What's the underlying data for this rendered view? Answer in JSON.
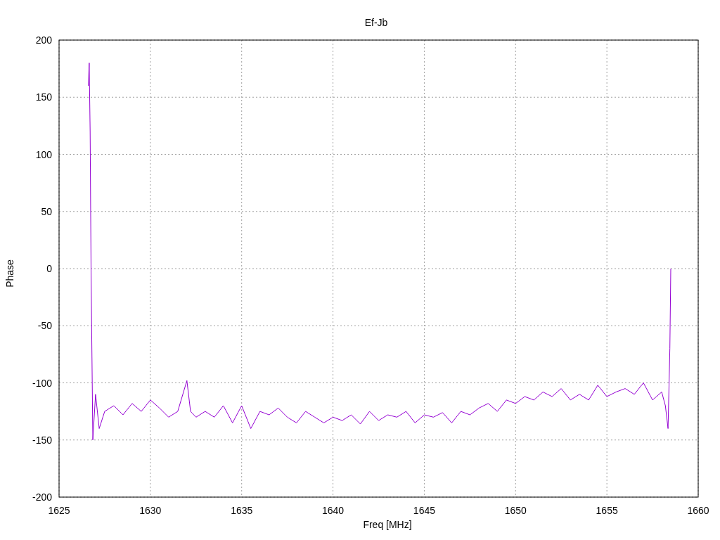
{
  "chart_data": {
    "type": "line",
    "title": "Ef-Jb",
    "xlabel": "Freq [MHz]",
    "ylabel": "Phase",
    "x": [
      1626.6,
      1626.65,
      1626.7,
      1626.75,
      1626.85,
      1627,
      1627.2,
      1627.5,
      1628,
      1628.5,
      1629,
      1629.5,
      1630,
      1630.5,
      1631,
      1631.5,
      1632,
      1632.2,
      1632.5,
      1633,
      1633.5,
      1634,
      1634.5,
      1635,
      1635.5,
      1636,
      1636.5,
      1637,
      1637.5,
      1638,
      1638.5,
      1639,
      1639.5,
      1640,
      1640.5,
      1641,
      1641.5,
      1642,
      1642.5,
      1643,
      1643.5,
      1644,
      1644.5,
      1645,
      1645.5,
      1646,
      1646.5,
      1647,
      1647.5,
      1648,
      1648.5,
      1649,
      1649.5,
      1650,
      1650.5,
      1651,
      1651.5,
      1652,
      1652.5,
      1653,
      1653.5,
      1654,
      1654.5,
      1655,
      1655.5,
      1656,
      1656.5,
      1657,
      1657.5,
      1658,
      1658.2,
      1658.35,
      1658.45,
      1658.5
    ],
    "grid": true,
    "series": [
      {
        "color": "#9400d3",
        "values": [
          160,
          180,
          120,
          0,
          -150,
          -110,
          -140,
          -125,
          -120,
          -128,
          -118,
          -125,
          -115,
          -122,
          -130,
          -125,
          -98,
          -125,
          -130,
          -125,
          -130,
          -120,
          -135,
          -120,
          -140,
          -125,
          -128,
          -122,
          -130,
          -135,
          -125,
          -130,
          -135,
          -130,
          -133,
          -128,
          -136,
          -125,
          -133,
          -128,
          -130,
          -125,
          -135,
          -128,
          -130,
          -126,
          -135,
          -125,
          -128,
          -122,
          -118,
          -125,
          -115,
          -118,
          -112,
          -115,
          -108,
          -112,
          -105,
          -115,
          -110,
          -115,
          -102,
          -112,
          -108,
          -105,
          -110,
          -100,
          -115,
          -108,
          -120,
          -140,
          -70,
          0
        ]
      }
    ],
    "xlim": [
      1625,
      1660
    ],
    "ylim": [
      -200,
      200
    ],
    "xticks": [
      1625,
      1630,
      1635,
      1640,
      1645,
      1650,
      1655,
      1660
    ],
    "yticks": [
      -200,
      -150,
      -100,
      -50,
      0,
      50,
      100,
      150,
      200
    ]
  }
}
